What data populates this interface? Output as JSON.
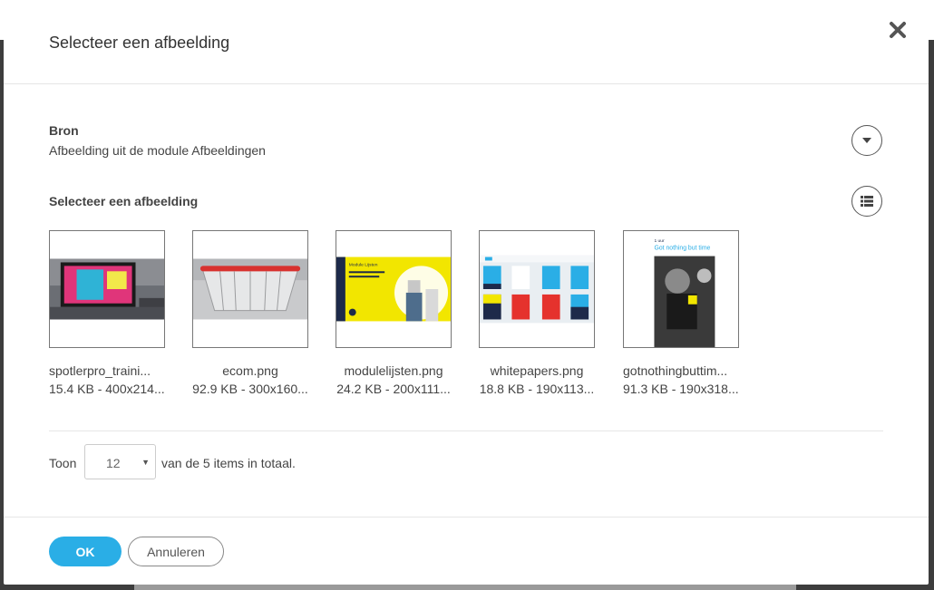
{
  "modal": {
    "title": "Selecteer een afbeelding"
  },
  "source": {
    "label": "Bron",
    "value": "Afbeelding uit de module Afbeeldingen"
  },
  "gallery": {
    "label": "Selecteer een afbeelding",
    "items": [
      {
        "name": "spotlerpro_traini...",
        "meta": "15.4 KB - 400x214..."
      },
      {
        "name": "ecom.png",
        "meta": "92.9 KB - 300x160..."
      },
      {
        "name": "modulelijsten.png",
        "meta": "24.2 KB - 200x111..."
      },
      {
        "name": "whitepapers.png",
        "meta": "18.8 KB - 190x113..."
      },
      {
        "name": "gotnothingbuttim...",
        "meta": "91.3 KB - 190x318..."
      }
    ]
  },
  "thumb_text": {
    "modulelijsten_heading": "Module Lijsten",
    "gotnothing_top": "1 uur",
    "gotnothing_headline": "Got nothing but time"
  },
  "pager": {
    "show_label": "Toon",
    "page_size": "12",
    "total_text": "van de 5 items in totaal."
  },
  "footer": {
    "ok_label": "OK",
    "cancel_label": "Annuleren"
  },
  "colors": {
    "accent": "#2aaee6",
    "yellow": "#f2e600",
    "navy": "#1d2a4a"
  }
}
